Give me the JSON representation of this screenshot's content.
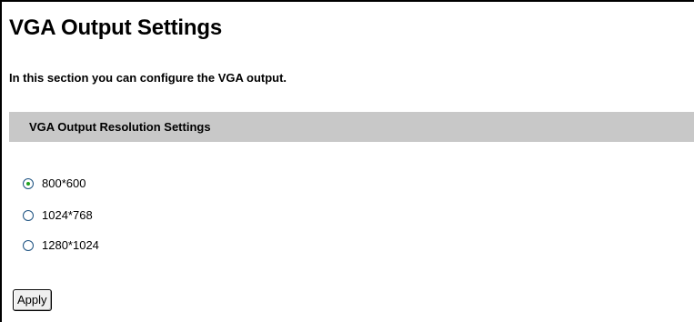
{
  "page": {
    "title": "VGA Output Settings",
    "intro": "In this section you can configure the VGA output."
  },
  "section": {
    "title": "VGA Output Resolution Settings"
  },
  "resolution_options": [
    {
      "label": "800*600",
      "selected": true
    },
    {
      "label": "1024*768",
      "selected": false
    },
    {
      "label": "1280*1024",
      "selected": false
    }
  ],
  "actions": {
    "apply_label": "Apply"
  },
  "colors": {
    "section_bar": "#c8c8c8",
    "radio_dot": "#21a121",
    "radio_border": "#1c5180"
  }
}
